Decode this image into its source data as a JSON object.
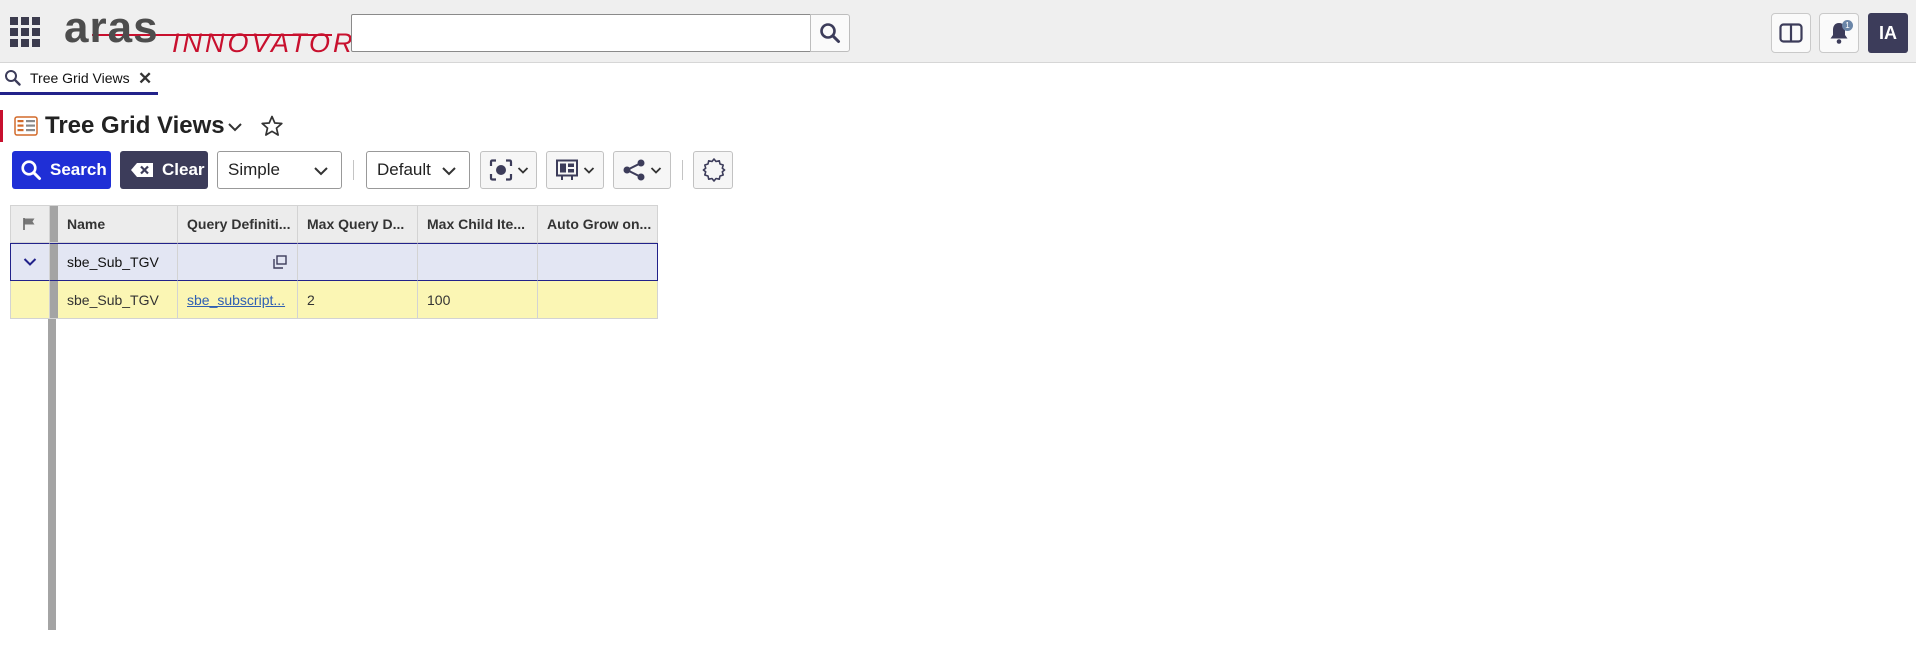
{
  "header": {
    "logo_primary": "aras",
    "logo_secondary": "INNOVATOR",
    "search_value": "",
    "notification_count": "1",
    "avatar_initials": "IA"
  },
  "tabs": [
    {
      "label": "Tree Grid Views"
    }
  ],
  "page": {
    "title": "Tree Grid Views"
  },
  "toolbar": {
    "search_label": "Search",
    "clear_label": "Clear",
    "mode_value": "Simple",
    "view_value": "Default"
  },
  "grid": {
    "columns": [
      "",
      "Name",
      "Query Definiti...",
      "Max Query D...",
      "Max Child Ite...",
      "Auto Grow on..."
    ],
    "group_row": {
      "name": "sbe_Sub_TGV"
    },
    "rows": [
      {
        "name": "sbe_Sub_TGV",
        "query_definition": "sbe_subscript...",
        "max_query_depth": "2",
        "max_child_items": "100",
        "auto_grow": ""
      }
    ]
  },
  "colors": {
    "accent_blue": "#1f2fd6",
    "dark_button": "#3c3c5a",
    "brand_red": "#c8102e",
    "row_highlight": "#fbf6b4",
    "group_row": "#e3e6f3"
  }
}
